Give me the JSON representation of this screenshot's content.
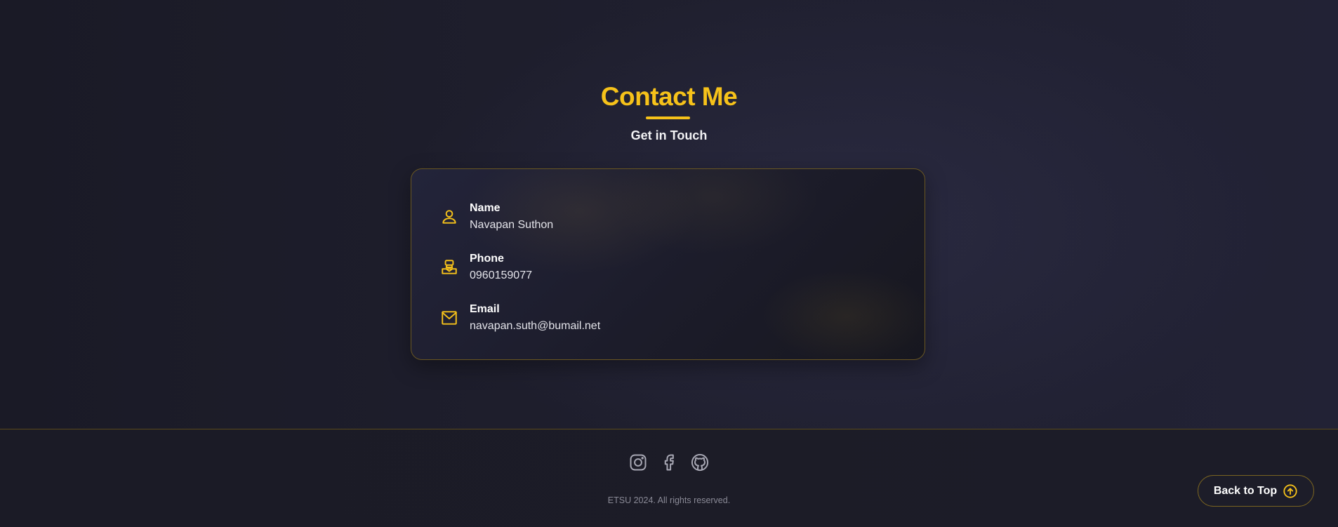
{
  "contact": {
    "title": "Contact Me",
    "subtitle": "Get in Touch",
    "items": [
      {
        "label": "Name",
        "value": "Navapan Suthon",
        "icon": "user-icon"
      },
      {
        "label": "Phone",
        "value": "0960159077",
        "icon": "phone-icon"
      },
      {
        "label": "Email",
        "value": "navapan.suth@bumail.net",
        "icon": "mail-icon"
      }
    ]
  },
  "footer": {
    "social": [
      "instagram-icon",
      "facebook-icon",
      "github-icon"
    ],
    "copyright": "ETSU 2024. All rights reserved.",
    "back_to_top": "Back to Top"
  },
  "colors": {
    "accent": "#f6c21a",
    "background": "#1c1c29",
    "card_border": "#6a5722",
    "muted_text": "#8a8a96"
  }
}
